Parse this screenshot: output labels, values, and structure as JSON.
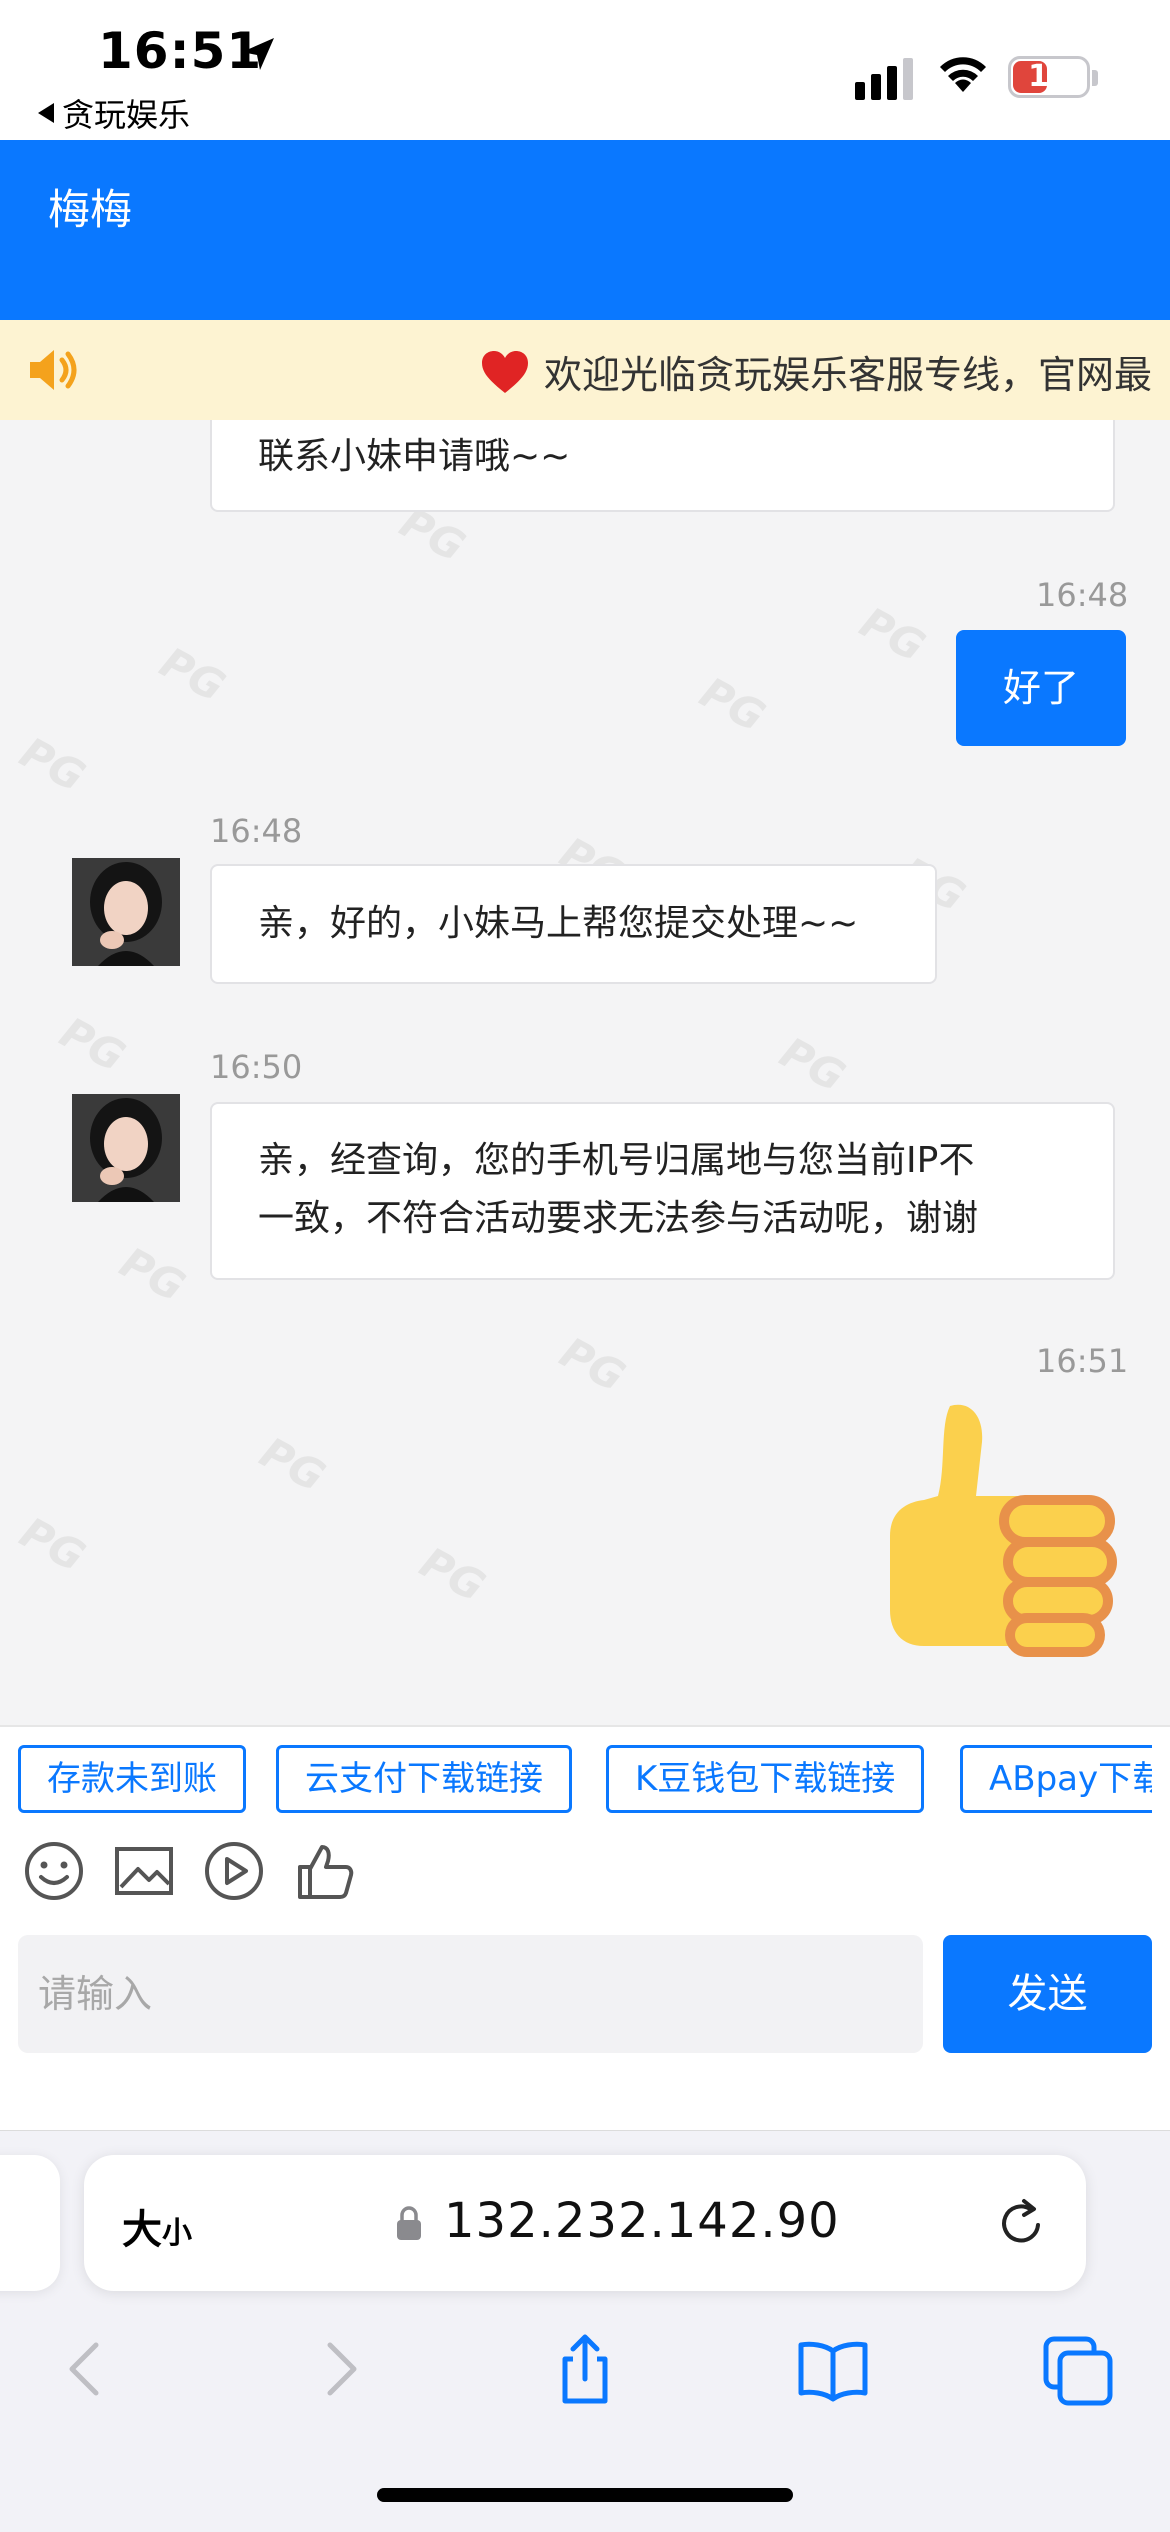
{
  "status_bar": {
    "time": "16:51",
    "back_app": "贪玩娱乐",
    "battery": "10"
  },
  "header": {
    "title": "梅梅"
  },
  "notice": {
    "text": "欢迎光临贪玩娱乐客服专线，官网最"
  },
  "messages": [
    {
      "side": "in",
      "text": "联系小妹申请哦~~"
    },
    {
      "side": "out",
      "time": "16:48",
      "text": "好了"
    },
    {
      "side": "in",
      "time": "16:48",
      "text": "亲，好的，小妹马上帮您提交处理~~"
    },
    {
      "side": "in",
      "time": "16:50",
      "line1": "亲，经查询，您的手机号归属地与您当前IP不",
      "line2": "一致，不符合活动要求无法参与活动呢，谢谢"
    },
    {
      "side": "out",
      "time": "16:51",
      "sticker": "thumbs-up"
    }
  ],
  "quick_replies": [
    "存款未到账",
    "云支付下载链接",
    "K豆钱包下载链接",
    "ABpay下载"
  ],
  "composer": {
    "placeholder": "请输入",
    "send_label": "发送"
  },
  "safari": {
    "text_size": "大",
    "text_size_small": "小",
    "url": "132.232.142.90"
  },
  "watermark": "PG"
}
